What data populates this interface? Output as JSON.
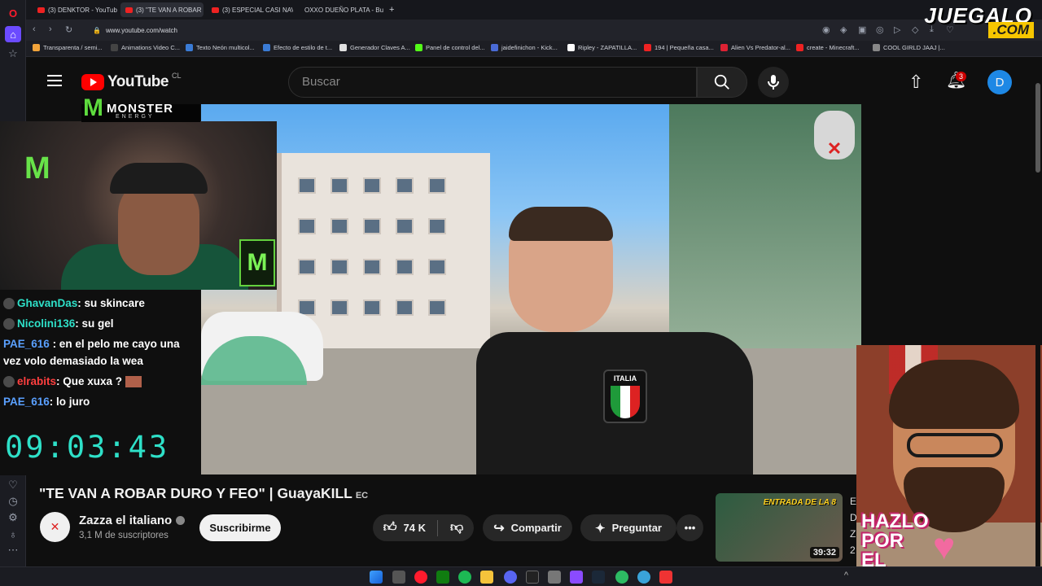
{
  "browser": {
    "tabs": [
      {
        "label": "(3) DENKTOR - YouTube",
        "active": false
      },
      {
        "label": "(3) \"TE VAN A ROBAR",
        "active": true
      },
      {
        "label": "(3) ESPECIAL CASI NAV",
        "active": false
      },
      {
        "label": "OXXO DUEÑO PLATA - Bu",
        "active": false
      }
    ],
    "new_tab": "+",
    "url": "www.youtube.com/watch",
    "bookmarks": [
      {
        "label": "Transparenta / semi...",
        "color": "#f2a33a"
      },
      {
        "label": "Animations Video C...",
        "color": "#444"
      },
      {
        "label": "Texto Neón multicol...",
        "color": "#3a7bd5"
      },
      {
        "label": "Efecto de estilo de t...",
        "color": "#3a7bd5"
      },
      {
        "label": "Generador Claves A...",
        "color": "#e0e0e0"
      },
      {
        "label": "Panel de control del...",
        "color": "#53fc18"
      },
      {
        "label": "jaidefinichon - Kick...",
        "color": "#4a6bd6"
      },
      {
        "label": "Ripley - ZAPATILLA...",
        "color": "#ffffff"
      },
      {
        "label": "194 | Pequeña casa...",
        "color": "#e22"
      },
      {
        "label": "Alien Vs Predator-al...",
        "color": "#d23"
      },
      {
        "label": "create - Minecraft...",
        "color": "#e22"
      },
      {
        "label": "COOL GIRLD JAAJ |...",
        "color": "#888"
      }
    ]
  },
  "watermark": {
    "line1": "JUEGALO",
    "line2": ".COM"
  },
  "youtube": {
    "logo_text": "YouTube",
    "country_code": "CL",
    "search_placeholder": "Buscar",
    "notifications_count": "3",
    "avatar_letter": "D"
  },
  "overlay": {
    "sponsor": {
      "brand": "MONSTER",
      "sub": "ENERGY"
    },
    "chat": [
      {
        "user": "GhavanDas",
        "user_color": "#2ee0c8",
        "message": ": su skincare"
      },
      {
        "user": "Nicolini136",
        "user_color": "#2ee0c8",
        "message": ": su gel"
      },
      {
        "user": "PAE_616",
        "user_color": "#5aa0ff",
        "message": ": en el pelo me cayo una vez volo demasiado la wea"
      },
      {
        "user": "elrabits",
        "user_color": "#ff3f3f",
        "message": ": Que xuxa ?"
      },
      {
        "user": "PAE_616",
        "user_color": "#5aa0ff",
        "message": ": lo juro"
      }
    ],
    "clock": "09:03:43",
    "hazlo_text": [
      "HAZLO",
      "POR",
      "EL"
    ]
  },
  "video": {
    "patch_text": "ITALIA",
    "title": "\"TE VAN A ROBAR DURO Y FEO\" | GuayaKILL",
    "title_flag": "EC",
    "channel_name": "Zazza el italiano",
    "subscribers": "3,1 M de suscriptores",
    "subscribe_label": "Suscribirme",
    "likes": "74 K",
    "share_label": "Compartir",
    "ask_label": "Preguntar"
  },
  "recommended": {
    "thumb_title": "ENTRADA DE LA 8",
    "duration": "39:32",
    "side_letters": [
      "E",
      "D",
      "Z",
      "2"
    ]
  }
}
